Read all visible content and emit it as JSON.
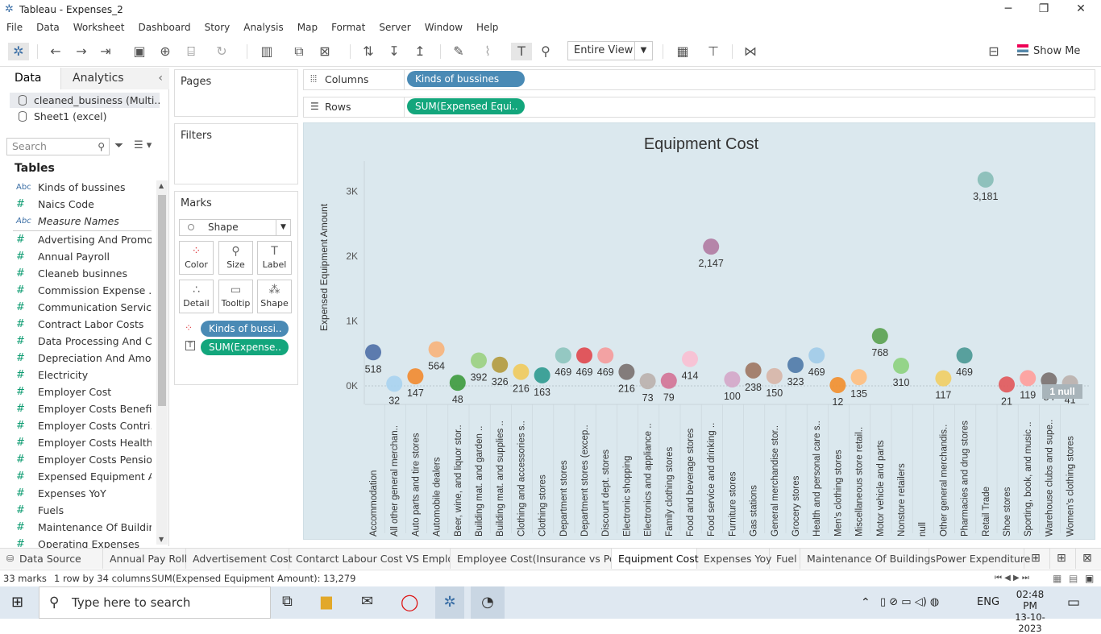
{
  "window": {
    "title": "Tableau - Expenses_2"
  },
  "menu": [
    "File",
    "Data",
    "Worksheet",
    "Dashboard",
    "Story",
    "Analysis",
    "Map",
    "Format",
    "Server",
    "Window",
    "Help"
  ],
  "toolbar": {
    "view_mode": "Entire View",
    "show_me": "Show Me"
  },
  "data_pane": {
    "tab_data": "Data",
    "tab_analytics": "Analytics",
    "sources": [
      "cleaned_business (Multi...",
      "Sheet1 (excel)"
    ],
    "search_placeholder": "Search",
    "tables_heading": "Tables",
    "fields": [
      {
        "type": "Abc",
        "name": "Kinds of bussines"
      },
      {
        "type": "#",
        "name": "Naics Code"
      },
      {
        "type": "Abc",
        "name": "Measure Names"
      },
      {
        "type": "#",
        "name": "Advertising And Promo..."
      },
      {
        "type": "#",
        "name": "Annual Payroll"
      },
      {
        "type": "#",
        "name": "Cleaneb businnes"
      },
      {
        "type": "#",
        "name": "Commission Expense ..."
      },
      {
        "type": "#",
        "name": "Communication Servic..."
      },
      {
        "type": "#",
        "name": "Contract Labor Costs"
      },
      {
        "type": "#",
        "name": "Data Processing And C..."
      },
      {
        "type": "#",
        "name": "Depreciation And Amo..."
      },
      {
        "type": "#",
        "name": "Electricity"
      },
      {
        "type": "#",
        "name": "Employer Cost"
      },
      {
        "type": "#",
        "name": "Employer Costs Benefits"
      },
      {
        "type": "#",
        "name": "Employer Costs Contri..."
      },
      {
        "type": "#",
        "name": "Employer Costs Health..."
      },
      {
        "type": "#",
        "name": "Employer Costs Pensio..."
      },
      {
        "type": "#",
        "name": "Expensed Equipment A..."
      },
      {
        "type": "#",
        "name": "Expenses YoY"
      },
      {
        "type": "#",
        "name": "Fuels"
      },
      {
        "type": "#",
        "name": "Maintenance Of Buildin..."
      },
      {
        "type": "#",
        "name": "Operating Expenses"
      }
    ]
  },
  "cards": {
    "pages": "Pages",
    "filters": "Filters",
    "marks": "Marks",
    "mark_type": "Shape",
    "mark_buttons": [
      "Color",
      "Size",
      "Label",
      "Detail",
      "Tooltip",
      "Shape"
    ],
    "mark_pills": [
      "Kinds of bussi..",
      "SUM(Expense.."
    ]
  },
  "shelves": {
    "columns_label": "Columns",
    "columns_pill": "Kinds of bussines",
    "rows_label": "Rows",
    "rows_pill": "SUM(Expensed Equi.."
  },
  "chart_data": {
    "type": "scatter",
    "title": "Equipment Cost",
    "ylabel": "Expensed Equipment Amount",
    "xlabel": "",
    "ylim": [
      -100,
      3500
    ],
    "yticks": [
      "0K",
      "1K",
      "2K",
      "3K"
    ],
    "null_badge": "1 null",
    "points": [
      {
        "category": "Accommodation",
        "value": 518,
        "label": "518",
        "color": "#4e6fa6"
      },
      {
        "category": "All other general merchan..",
        "value": 32,
        "label": "32",
        "color": "#a9d3f0"
      },
      {
        "category": "Auto parts and tire stores",
        "value": 147,
        "label": "147",
        "color": "#f28a2e"
      },
      {
        "category": "Automobile dealers",
        "value": 564,
        "label": "564",
        "color": "#f7b27a"
      },
      {
        "category": "Beer, wine, and liquor stor..",
        "value": 48,
        "label": "48",
        "color": "#3c9a3c"
      },
      {
        "category": "Building mat. and garden ..",
        "value": 392,
        "label": "392",
        "color": "#9ad07f"
      },
      {
        "category": "Building mat. and supplies ..",
        "value": 326,
        "label": "326",
        "color": "#b39a3c"
      },
      {
        "category": "Clothing and accessories s..",
        "value": 216,
        "label": "216",
        "color": "#f0ca5b"
      },
      {
        "category": "Clothing stores",
        "value": 163,
        "label": "163",
        "color": "#2e9a8f"
      },
      {
        "category": "Department stores",
        "value": 469,
        "label": "469",
        "color": "#8cc4bc"
      },
      {
        "category": "Department stores (excep..",
        "value": 469,
        "label": "469",
        "color": "#e0474c"
      },
      {
        "category": "Discount dept. stores",
        "value": 469,
        "label": "469",
        "color": "#f59a9a"
      },
      {
        "category": "Electronic shopping",
        "value": 216,
        "label": "216",
        "color": "#79706e"
      },
      {
        "category": "Electronics and appliance ..",
        "value": 73,
        "label": "73",
        "color": "#bab0ac"
      },
      {
        "category": "Family clothing stores",
        "value": 79,
        "label": "79",
        "color": "#d37295"
      },
      {
        "category": "Food and beverage stores",
        "value": 414,
        "label": "414",
        "color": "#fabfd2"
      },
      {
        "category": "Food service and drinking ..",
        "value": 2147,
        "label": "2,147",
        "color": "#b07aa1"
      },
      {
        "category": "Furniture stores",
        "value": 100,
        "label": "100",
        "color": "#d4a6c8"
      },
      {
        "category": "Gas stations",
        "value": 238,
        "label": "238",
        "color": "#9d7660"
      },
      {
        "category": "General merchandise stor..",
        "value": 150,
        "label": "150",
        "color": "#d7b5a6"
      },
      {
        "category": "Grocery stores",
        "value": 323,
        "label": "323",
        "color": "#4e79a7"
      },
      {
        "category": "Health and personal care s..",
        "value": 469,
        "label": "469",
        "color": "#a0cbe8"
      },
      {
        "category": "Men's clothing stores",
        "value": 12,
        "label": "12",
        "color": "#f28e2b"
      },
      {
        "category": "Miscellaneous store retail..",
        "value": 135,
        "label": "135",
        "color": "#ffbe7d"
      },
      {
        "category": "Motor vehicle and parts",
        "value": 768,
        "label": "768",
        "color": "#59a14f"
      },
      {
        "category": "Nonstore retailers",
        "value": 310,
        "label": "310",
        "color": "#8cd17d"
      },
      {
        "category": "null",
        "value": null,
        "label": "",
        "color": "#b6992d"
      },
      {
        "category": "Other general merchandis..",
        "value": 117,
        "label": "117",
        "color": "#f1ce63"
      },
      {
        "category": "Pharmacies and drug stores",
        "value": 469,
        "label": "469",
        "color": "#499894"
      },
      {
        "category": "Retail Trade",
        "value": 3181,
        "label": "3,181",
        "color": "#86bcb6"
      },
      {
        "category": "Shoe stores",
        "value": 21,
        "label": "21",
        "color": "#e15759"
      },
      {
        "category": "Sporting, book, and music ..",
        "value": 119,
        "label": "119",
        "color": "#ff9d9a"
      },
      {
        "category": "Warehouse clubs and supe..",
        "value": 84,
        "label": "84",
        "color": "#79706e"
      },
      {
        "category": "Women's clothing stores",
        "value": 41,
        "label": "41",
        "color": "#bab0ac"
      }
    ]
  },
  "sheet_tabs": [
    "Data Source",
    "Annual Pay Roll",
    "Advertisement Cost",
    "Contarct Labour Cost VS Emplo...",
    "Employee  Cost(Insurance vs Pe...",
    "Equipment Cost",
    "Expenses Yoy",
    "Fuel",
    "Maintenance Of Buildings",
    "Power Expenditure"
  ],
  "active_tab": "Equipment Cost",
  "status": {
    "marks": "33 marks",
    "shape": "1 row by 34 columns",
    "sum": "SUM(Expensed Equipment Amount): 13,279"
  },
  "taskbar": {
    "search_placeholder": "Type here to search",
    "lang": "ENG",
    "time": "02:48 PM",
    "date": "13-10-2023"
  }
}
